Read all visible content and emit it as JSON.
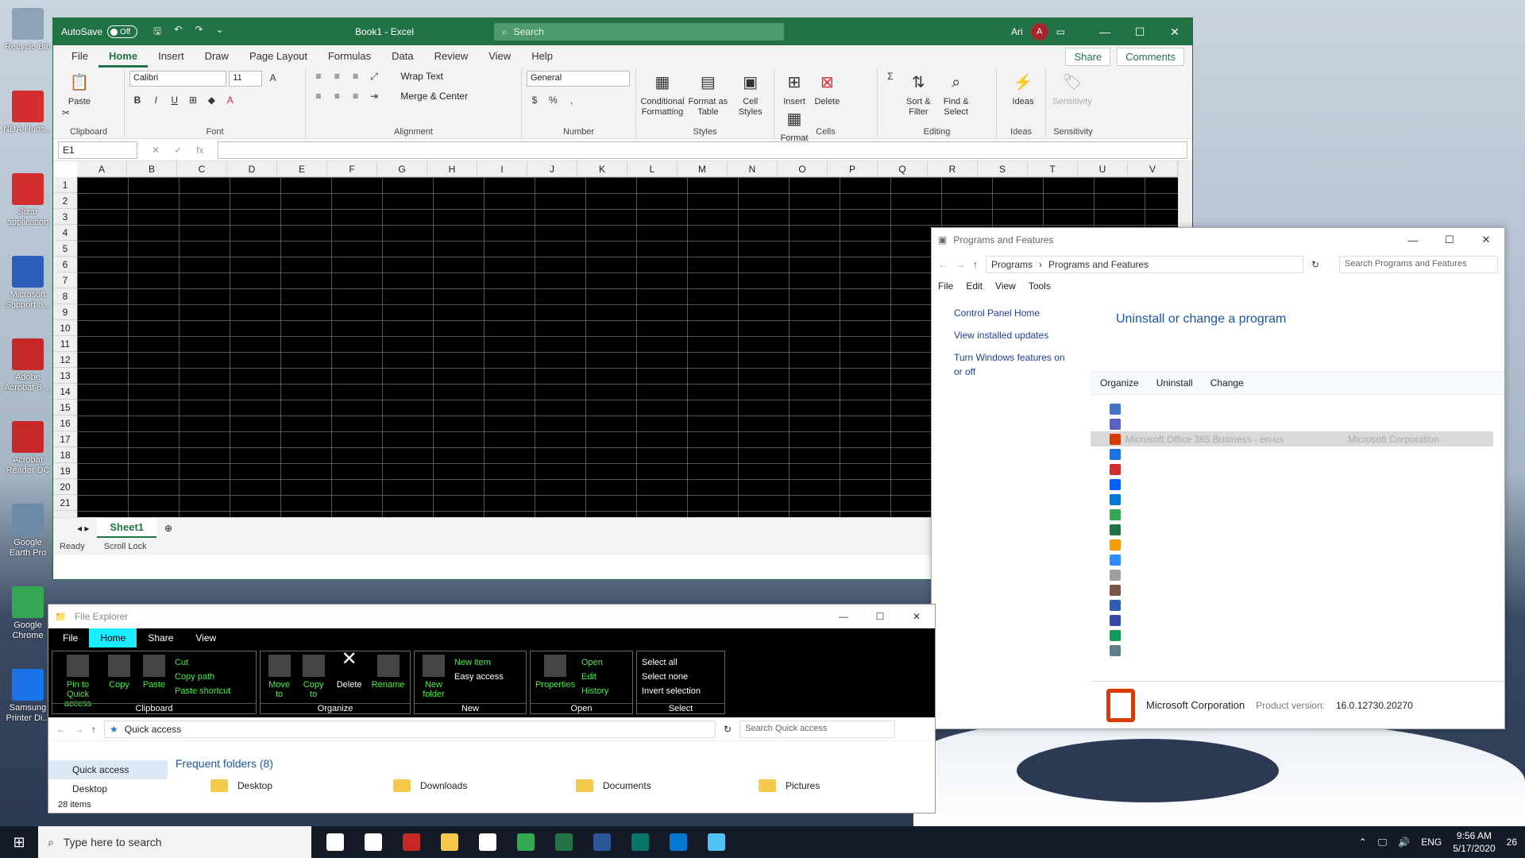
{
  "desktop": {
    "icons": [
      {
        "label": "Recycle Bin",
        "color": "#8fa3b8"
      },
      {
        "label": "NDA-Huds...",
        "color": "#d32f2f"
      },
      {
        "label": "Sizar application",
        "color": "#d32f2f"
      },
      {
        "label": "Microsoft Support a...",
        "color": "#2b5eb8"
      },
      {
        "label": "Adobe Acrobat 8 ...",
        "color": "#c62828"
      },
      {
        "label": "Acrobat Reader DC",
        "color": "#c62828"
      },
      {
        "label": "Google Earth Pro",
        "color": "#6b8aa6"
      },
      {
        "label": "Google Chrome",
        "color": "#34a853"
      },
      {
        "label": "Samsung Printer Di...",
        "color": "#1a73e8"
      }
    ]
  },
  "excel": {
    "autosave_label": "AutoSave",
    "autosave_state": "Off",
    "doc_title": "Book1 - Excel",
    "search_placeholder": "Search",
    "user_name": "Ari",
    "user_initial": "A",
    "tabs": [
      "File",
      "Home",
      "Insert",
      "Draw",
      "Page Layout",
      "Formulas",
      "Data",
      "Review",
      "View",
      "Help"
    ],
    "share_label": "Share",
    "comments_label": "Comments",
    "ribbon": {
      "clipboard": {
        "paste": "Paste",
        "label": "Clipboard"
      },
      "font": {
        "name": "Calibri",
        "size": "11",
        "label": "Font"
      },
      "alignment": {
        "wrap": "Wrap Text",
        "merge": "Merge & Center",
        "label": "Alignment"
      },
      "number": {
        "format": "General",
        "label": "Number"
      },
      "styles": {
        "conditional": "Conditional Formatting",
        "format_table": "Format as Table",
        "cell_styles": "Cell Styles",
        "label": "Styles"
      },
      "cells": {
        "insert": "Insert",
        "delete": "Delete",
        "format": "Format",
        "label": "Cells"
      },
      "editing": {
        "sort": "Sort & Filter",
        "find": "Find & Select",
        "label": "Editing"
      },
      "ideas": {
        "btn": "Ideas",
        "label": "Ideas"
      },
      "sensitivity": {
        "btn": "Sensitivity",
        "label": "Sensitivity"
      }
    },
    "name_box": "E1",
    "columns": [
      "A",
      "B",
      "C",
      "D",
      "E",
      "F",
      "G",
      "H",
      "I",
      "J",
      "K",
      "L",
      "M",
      "N",
      "O",
      "P",
      "Q",
      "R",
      "S",
      "T",
      "U",
      "V"
    ],
    "rows": [
      "1",
      "2",
      "3",
      "4",
      "5",
      "6",
      "7",
      "8",
      "9",
      "10",
      "11",
      "12",
      "13",
      "14",
      "15",
      "16",
      "17",
      "18",
      "19",
      "20",
      "21"
    ],
    "sheet_tab": "Sheet1",
    "status": {
      "ready": "Ready",
      "scroll_lock": "Scroll Lock"
    },
    "accent": "#217346"
  },
  "programs": {
    "title": "Programs and Features",
    "breadcrumb": [
      "Programs",
      "Programs and Features"
    ],
    "search_placeholder": "Search Programs and Features",
    "menu": [
      "File",
      "Edit",
      "View",
      "Tools"
    ],
    "links": [
      "Control Panel Home",
      "View installed updates",
      "Turn Windows features on or off"
    ],
    "heading": "Uninstall or change a program",
    "toolbar": [
      "Organize",
      "Uninstall",
      "Change"
    ],
    "selected_name": "Microsoft Office 365 Business - en-us",
    "selected_publisher": "Microsoft Corporation",
    "list_icon_colors": [
      "#4472c4",
      "#5b5fc7",
      "#d83b01",
      "#1a73e8",
      "#d32f2f",
      "#0061ff",
      "#0078d4",
      "#34a853",
      "#217346",
      "#f59e0b",
      "#2d8cff",
      "#9e9e9e",
      "#795548",
      "#2b5eb8",
      "#3949ab",
      "#0f9d58",
      "#607d8b"
    ],
    "detail_publisher": "Microsoft Corporation",
    "detail_version_label": "Product version:",
    "detail_version": "16.0.12730.20270"
  },
  "explorer": {
    "title": "File Explorer",
    "tabs": [
      "File",
      "Home",
      "Share",
      "View"
    ],
    "clipboard": {
      "pin": "Pin to Quick access",
      "copy": "Copy",
      "paste": "Paste",
      "cut": "Cut",
      "copy_path": "Copy path",
      "paste_shortcut": "Paste shortcut",
      "label": "Clipboard"
    },
    "organize": {
      "move": "Move to",
      "copy": "Copy to",
      "delete": "Delete",
      "rename": "Rename",
      "label": "Organize"
    },
    "new": {
      "folder": "New folder",
      "item": "New item",
      "easy": "Easy access",
      "label": "New"
    },
    "open": {
      "properties": "Properties",
      "open": "Open",
      "edit": "Edit",
      "history": "History",
      "label": "Open"
    },
    "select": {
      "all": "Select all",
      "none": "Select none",
      "invert": "Invert selection",
      "label": "Select"
    },
    "path": "Quick access",
    "search_placeholder": "Search Quick access",
    "nav": [
      "Quick access",
      "Desktop"
    ],
    "frequent_heading": "Frequent folders (8)",
    "folders": [
      "Desktop",
      "Downloads",
      "Documents",
      "Pictures"
    ],
    "item_count": "28 items"
  },
  "taskbar": {
    "search_placeholder": "Type here to search",
    "language": "ENG",
    "time": "9:56 AM",
    "date": "5/17/2020",
    "notifications": "26",
    "app_colors": [
      "#ffffff",
      "#ffffff",
      "#c62828",
      "#f5c94c",
      "#ffffff",
      "#34a853",
      "#217346",
      "#2b579a",
      "#077568",
      "#0078d4",
      "#4fc3f7"
    ]
  }
}
